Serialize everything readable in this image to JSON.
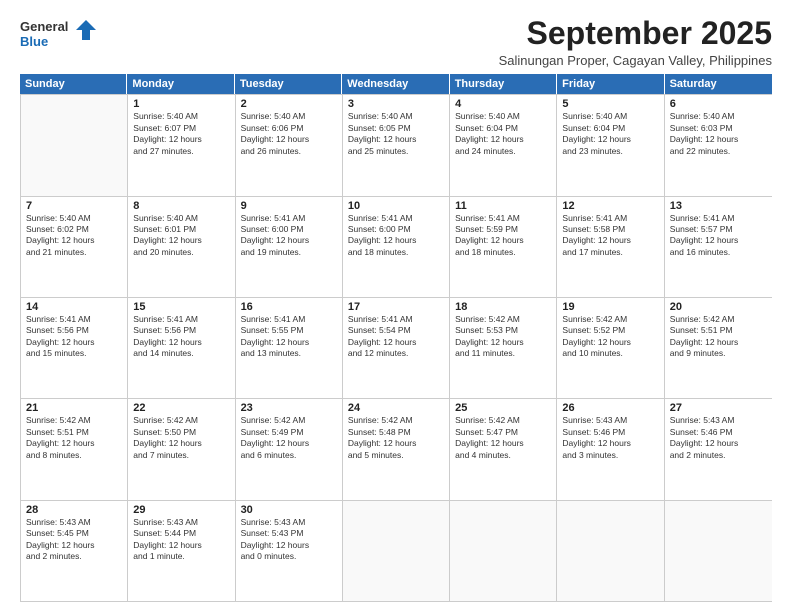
{
  "logo": {
    "general": "General",
    "blue": "Blue"
  },
  "title": "September 2025",
  "location": "Salinungan Proper, Cagayan Valley, Philippines",
  "weekdays": [
    "Sunday",
    "Monday",
    "Tuesday",
    "Wednesday",
    "Thursday",
    "Friday",
    "Saturday"
  ],
  "weeks": [
    [
      {
        "day": "",
        "info": ""
      },
      {
        "day": "1",
        "info": "Sunrise: 5:40 AM\nSunset: 6:07 PM\nDaylight: 12 hours\nand 27 minutes."
      },
      {
        "day": "2",
        "info": "Sunrise: 5:40 AM\nSunset: 6:06 PM\nDaylight: 12 hours\nand 26 minutes."
      },
      {
        "day": "3",
        "info": "Sunrise: 5:40 AM\nSunset: 6:05 PM\nDaylight: 12 hours\nand 25 minutes."
      },
      {
        "day": "4",
        "info": "Sunrise: 5:40 AM\nSunset: 6:04 PM\nDaylight: 12 hours\nand 24 minutes."
      },
      {
        "day": "5",
        "info": "Sunrise: 5:40 AM\nSunset: 6:04 PM\nDaylight: 12 hours\nand 23 minutes."
      },
      {
        "day": "6",
        "info": "Sunrise: 5:40 AM\nSunset: 6:03 PM\nDaylight: 12 hours\nand 22 minutes."
      }
    ],
    [
      {
        "day": "7",
        "info": "Sunrise: 5:40 AM\nSunset: 6:02 PM\nDaylight: 12 hours\nand 21 minutes."
      },
      {
        "day": "8",
        "info": "Sunrise: 5:40 AM\nSunset: 6:01 PM\nDaylight: 12 hours\nand 20 minutes."
      },
      {
        "day": "9",
        "info": "Sunrise: 5:41 AM\nSunset: 6:00 PM\nDaylight: 12 hours\nand 19 minutes."
      },
      {
        "day": "10",
        "info": "Sunrise: 5:41 AM\nSunset: 6:00 PM\nDaylight: 12 hours\nand 18 minutes."
      },
      {
        "day": "11",
        "info": "Sunrise: 5:41 AM\nSunset: 5:59 PM\nDaylight: 12 hours\nand 18 minutes."
      },
      {
        "day": "12",
        "info": "Sunrise: 5:41 AM\nSunset: 5:58 PM\nDaylight: 12 hours\nand 17 minutes."
      },
      {
        "day": "13",
        "info": "Sunrise: 5:41 AM\nSunset: 5:57 PM\nDaylight: 12 hours\nand 16 minutes."
      }
    ],
    [
      {
        "day": "14",
        "info": "Sunrise: 5:41 AM\nSunset: 5:56 PM\nDaylight: 12 hours\nand 15 minutes."
      },
      {
        "day": "15",
        "info": "Sunrise: 5:41 AM\nSunset: 5:56 PM\nDaylight: 12 hours\nand 14 minutes."
      },
      {
        "day": "16",
        "info": "Sunrise: 5:41 AM\nSunset: 5:55 PM\nDaylight: 12 hours\nand 13 minutes."
      },
      {
        "day": "17",
        "info": "Sunrise: 5:41 AM\nSunset: 5:54 PM\nDaylight: 12 hours\nand 12 minutes."
      },
      {
        "day": "18",
        "info": "Sunrise: 5:42 AM\nSunset: 5:53 PM\nDaylight: 12 hours\nand 11 minutes."
      },
      {
        "day": "19",
        "info": "Sunrise: 5:42 AM\nSunset: 5:52 PM\nDaylight: 12 hours\nand 10 minutes."
      },
      {
        "day": "20",
        "info": "Sunrise: 5:42 AM\nSunset: 5:51 PM\nDaylight: 12 hours\nand 9 minutes."
      }
    ],
    [
      {
        "day": "21",
        "info": "Sunrise: 5:42 AM\nSunset: 5:51 PM\nDaylight: 12 hours\nand 8 minutes."
      },
      {
        "day": "22",
        "info": "Sunrise: 5:42 AM\nSunset: 5:50 PM\nDaylight: 12 hours\nand 7 minutes."
      },
      {
        "day": "23",
        "info": "Sunrise: 5:42 AM\nSunset: 5:49 PM\nDaylight: 12 hours\nand 6 minutes."
      },
      {
        "day": "24",
        "info": "Sunrise: 5:42 AM\nSunset: 5:48 PM\nDaylight: 12 hours\nand 5 minutes."
      },
      {
        "day": "25",
        "info": "Sunrise: 5:42 AM\nSunset: 5:47 PM\nDaylight: 12 hours\nand 4 minutes."
      },
      {
        "day": "26",
        "info": "Sunrise: 5:43 AM\nSunset: 5:46 PM\nDaylight: 12 hours\nand 3 minutes."
      },
      {
        "day": "27",
        "info": "Sunrise: 5:43 AM\nSunset: 5:46 PM\nDaylight: 12 hours\nand 2 minutes."
      }
    ],
    [
      {
        "day": "28",
        "info": "Sunrise: 5:43 AM\nSunset: 5:45 PM\nDaylight: 12 hours\nand 2 minutes."
      },
      {
        "day": "29",
        "info": "Sunrise: 5:43 AM\nSunset: 5:44 PM\nDaylight: 12 hours\nand 1 minute."
      },
      {
        "day": "30",
        "info": "Sunrise: 5:43 AM\nSunset: 5:43 PM\nDaylight: 12 hours\nand 0 minutes."
      },
      {
        "day": "",
        "info": ""
      },
      {
        "day": "",
        "info": ""
      },
      {
        "day": "",
        "info": ""
      },
      {
        "day": "",
        "info": ""
      }
    ]
  ]
}
